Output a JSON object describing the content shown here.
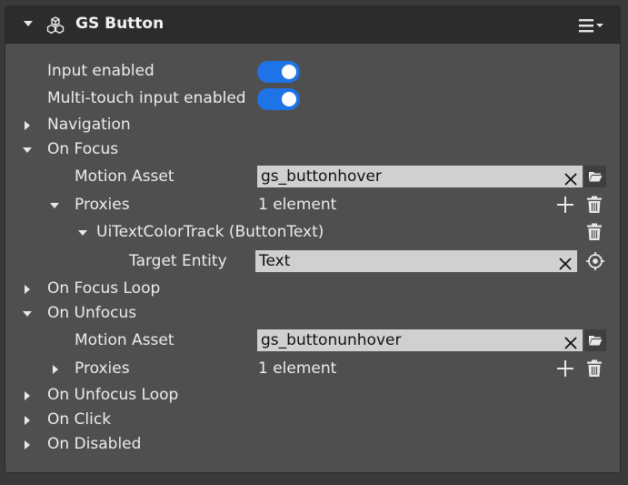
{
  "header": {
    "title": "GS Button"
  },
  "properties": {
    "input_enabled_label": "Input enabled",
    "input_enabled": true,
    "multitouch_label": "Multi-touch input enabled",
    "multitouch": true,
    "navigation_label": "Navigation",
    "on_focus": {
      "label": "On Focus",
      "motion_asset_label": "Motion Asset",
      "motion_asset_value": "gs_buttonhover",
      "proxies_label": "Proxies",
      "proxies_count": "1 element",
      "track_label": "UiTextColorTrack (ButtonText)",
      "target_entity_label": "Target Entity",
      "target_entity_value": "Text"
    },
    "on_focus_loop_label": "On Focus Loop",
    "on_unfocus": {
      "label": "On Unfocus",
      "motion_asset_label": "Motion Asset",
      "motion_asset_value": "gs_buttonunhover",
      "proxies_label": "Proxies",
      "proxies_count": "1 element"
    },
    "on_unfocus_loop_label": "On Unfocus Loop",
    "on_click_label": "On Click",
    "on_disabled_label": "On Disabled"
  },
  "icons": {
    "component": "cubes-icon",
    "menu": "hamburger-menu-icon",
    "clear": "clear-x-icon",
    "browse": "folder-open-icon",
    "add": "plus-icon",
    "delete": "trash-icon",
    "pick": "crosshair-target-icon"
  },
  "colors": {
    "accent": "#1e73e6",
    "panel": "#4f4f4f",
    "header": "#2c2c2c",
    "field": "#d0d0d0"
  }
}
